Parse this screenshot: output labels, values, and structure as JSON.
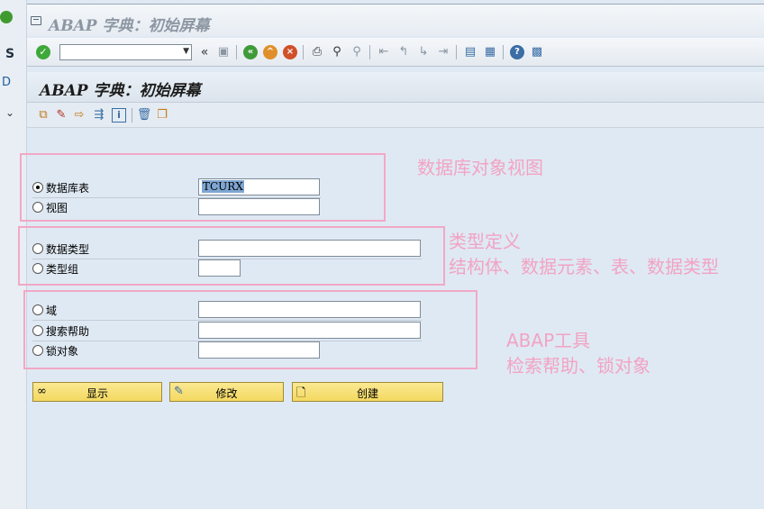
{
  "window": {
    "title": "ABAP 字典：初始屏幕"
  },
  "background_app": {
    "char_s": "S",
    "char_d": "D"
  },
  "toolbar": {
    "command_field": "",
    "icons": [
      "enter-icon",
      "back-double-icon",
      "save-icon",
      "back-icon",
      "exit-icon",
      "cancel-icon",
      "print-icon",
      "find-icon",
      "find-next-icon",
      "first-page-icon",
      "prev-page-icon",
      "next-page-icon",
      "last-page-icon",
      "new-session-icon",
      "shortcut-icon",
      "help-icon",
      "layout-icon"
    ]
  },
  "app": {
    "title": "ABAP 字典：初始屏幕",
    "toolbar_icons": [
      "other-object-icon",
      "change-icon",
      "display-icon",
      "activate-icon",
      "info-icon",
      "delete-icon",
      "copy-icon"
    ]
  },
  "groups": {
    "db": {
      "options": [
        {
          "label": "数据库表",
          "selected": true,
          "value": "TCURX"
        },
        {
          "label": "视图",
          "selected": false,
          "value": ""
        }
      ]
    },
    "type": {
      "options": [
        {
          "label": "数据类型",
          "selected": false,
          "value": ""
        },
        {
          "label": "类型组",
          "selected": false,
          "value": ""
        }
      ]
    },
    "tools": {
      "options": [
        {
          "label": "域",
          "selected": false,
          "value": ""
        },
        {
          "label": "搜索帮助",
          "selected": false,
          "value": ""
        },
        {
          "label": "锁对象",
          "selected": false,
          "value": ""
        }
      ]
    }
  },
  "annotations": {
    "db": "数据库对象视图",
    "type_line1": "类型定义",
    "type_line2": "结构体、数据元素、表、数据类型",
    "tools_line1": "ABAP工具",
    "tools_line2": "检索帮助、锁对象"
  },
  "buttons": {
    "display": "显示",
    "change": "修改",
    "create": "创建"
  },
  "colors": {
    "annotation": "#f2a3c4",
    "button_bg": "#f7e27a",
    "window_bg": "#dfe9f3"
  }
}
